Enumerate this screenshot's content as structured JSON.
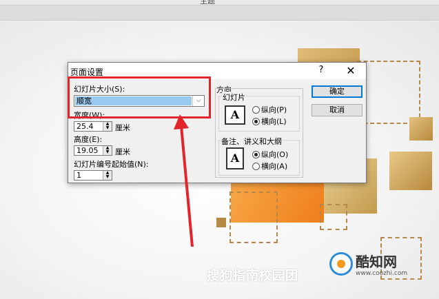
{
  "app": {
    "title_fragment": "主题"
  },
  "dialog": {
    "title": "页面设置",
    "help": "?",
    "close": "✕",
    "slide_size": {
      "label": "幻灯片大小(S):",
      "value": "顺宽",
      "arrow": "⌵"
    },
    "width": {
      "label": "宽度(W):",
      "value": "25.4",
      "unit": "厘米"
    },
    "height": {
      "label": "高度(E):",
      "value": "19.05",
      "unit": "厘米"
    },
    "start_number": {
      "label": "幻灯片编号起始值(N):",
      "value": "1"
    },
    "spin": {
      "up": "▲",
      "down": "▼"
    },
    "orientation": {
      "title": "方向",
      "slides": {
        "legend": "幻灯片",
        "icon_letter": "A",
        "portrait": "纵向(P)",
        "landscape": "横向(L)",
        "selected": "landscape"
      },
      "notes": {
        "legend": "备注、讲义和大纲",
        "icon_letter": "A",
        "portrait": "纵向(O)",
        "landscape": "横向(A)",
        "selected": "portrait"
      }
    },
    "ok_label": "确定",
    "cancel_label": "取消"
  },
  "watermark": "搜狗指南校园团",
  "logo": {
    "name": "酷知网",
    "url": "www.coozhi.com"
  },
  "colors": {
    "highlight": "#e3242b",
    "accent_orange": "#ef7e1a",
    "gold": "#c29a4c"
  }
}
